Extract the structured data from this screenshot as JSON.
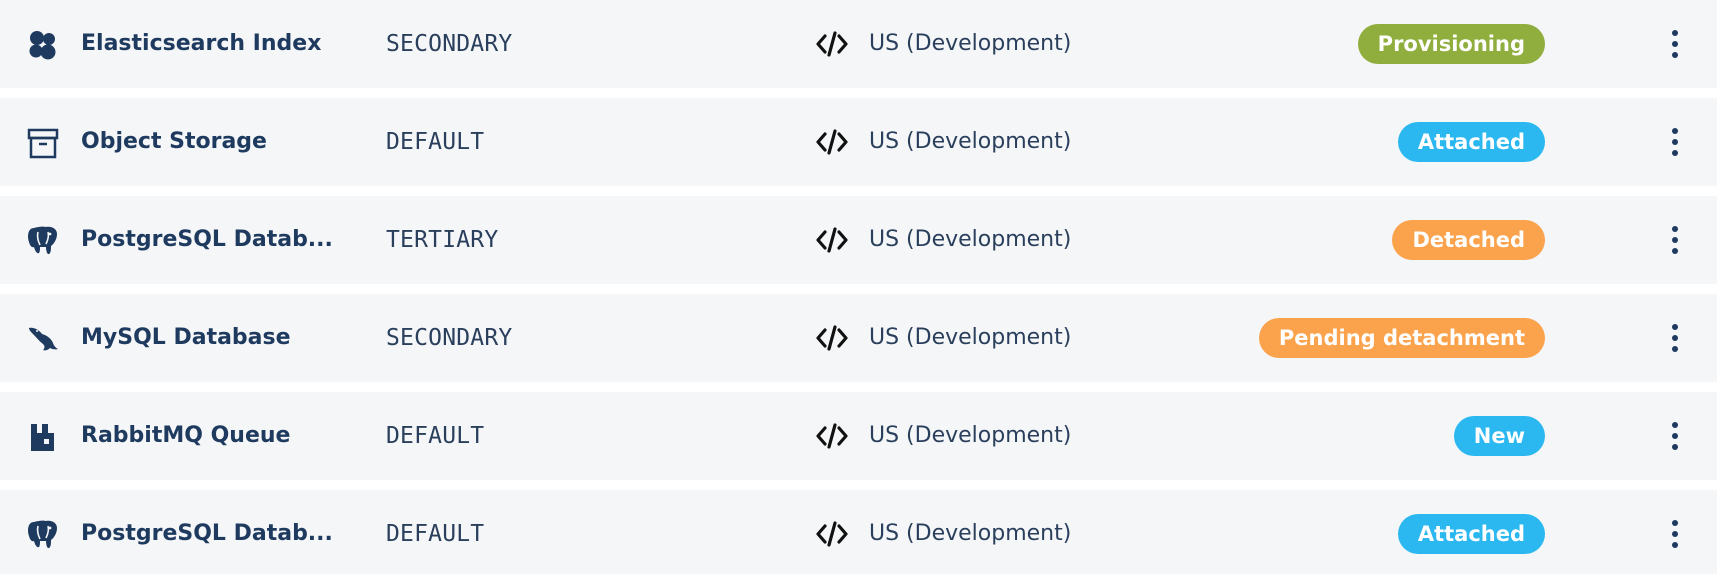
{
  "colors": {
    "row_bg": "#f5f6f8",
    "text_primary": "#1e3a5f",
    "status_provisioning": "#8fae3e",
    "status_attached": "#2bb8f0",
    "status_detached": "#fba24c",
    "status_pending_detachment": "#fba24c",
    "status_new": "#2bb8f0"
  },
  "rows": [
    {
      "icon": "elasticsearch-icon",
      "name": "Elasticsearch Index",
      "plan": "SECONDARY",
      "environment_icon": "code-icon",
      "region": "US (Development)",
      "status": "Provisioning",
      "status_color": "#8fae3e",
      "menu_icon": "more-vertical-icon"
    },
    {
      "icon": "archive-box-icon",
      "name": "Object Storage",
      "plan": "DEFAULT",
      "environment_icon": "code-icon",
      "region": "US (Development)",
      "status": "Attached",
      "status_color": "#2bb8f0",
      "menu_icon": "more-vertical-icon"
    },
    {
      "icon": "postgresql-elephant-icon",
      "name": "PostgreSQL Datab...",
      "plan": "TERTIARY",
      "environment_icon": "code-icon",
      "region": "US (Development)",
      "status": "Detached",
      "status_color": "#fba24c",
      "menu_icon": "more-vertical-icon"
    },
    {
      "icon": "mysql-dolphin-icon",
      "name": "MySQL Database",
      "plan": "SECONDARY",
      "environment_icon": "code-icon",
      "region": "US (Development)",
      "status": "Pending detachment",
      "status_color": "#fba24c",
      "menu_icon": "more-vertical-icon"
    },
    {
      "icon": "rabbitmq-icon",
      "name": "RabbitMQ Queue",
      "plan": "DEFAULT",
      "environment_icon": "code-icon",
      "region": "US (Development)",
      "status": "New",
      "status_color": "#2bb8f0",
      "menu_icon": "more-vertical-icon"
    },
    {
      "icon": "postgresql-elephant-icon",
      "name": "PostgreSQL Datab...",
      "plan": "DEFAULT",
      "environment_icon": "code-icon",
      "region": "US (Development)",
      "status": "Attached",
      "status_color": "#2bb8f0",
      "menu_icon": "more-vertical-icon"
    }
  ]
}
